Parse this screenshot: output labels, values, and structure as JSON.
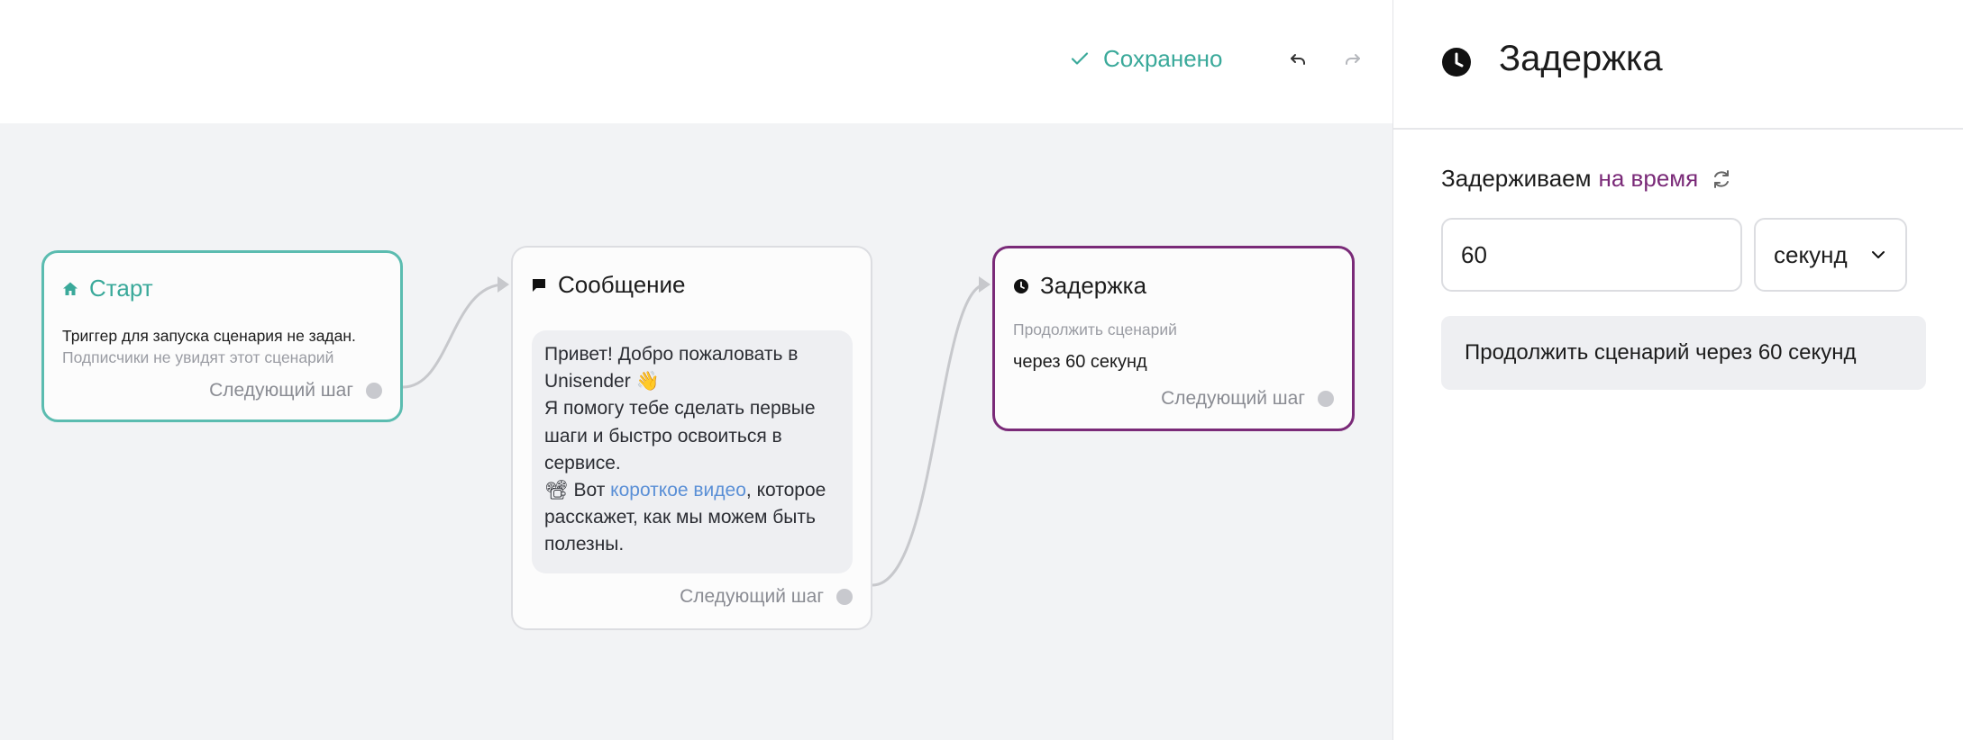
{
  "toolbar": {
    "saved_label": "Сохранено",
    "undo_icon": "undo-icon",
    "redo_icon": "redo-icon"
  },
  "nodes": {
    "start": {
      "icon": "home-icon",
      "title": "Старт",
      "line1": "Триггер для запуска сценария не задан.",
      "line2": "Подписчики не увидят этот сценарий",
      "next_step": "Следующий шаг"
    },
    "message": {
      "icon": "message-icon",
      "title": "Сообщение",
      "text_1": "Привет! Добро пожаловать в Unisender 👋",
      "text_2": "Я помогу тебе сделать первые шаги и быстро освоиться в сервисе.",
      "text_3_prefix": "📽 Вот ",
      "text_3_link": "короткое видео",
      "text_3_suffix": ", которое расскажет, как мы можем быть полезны.",
      "next_step": "Следующий шаг"
    },
    "delay": {
      "icon": "clock-icon",
      "title": "Задержка",
      "subtitle": "Продолжить сценарий",
      "value": "через 60 секунд",
      "next_step": "Следующий шаг"
    }
  },
  "panel": {
    "icon": "clock-icon",
    "title": "Задержка",
    "label_prefix": "Задерживаем",
    "label_mode": "на время",
    "switch_icon": "refresh-icon",
    "amount": "60",
    "unit": "секунд",
    "summary": "Продолжить сценарий через 60 секунд"
  },
  "colors": {
    "accent_teal": "#3aa99a",
    "start_border": "#5bbcb0",
    "delay_border": "#7a2a78",
    "link": "#5a8fd6",
    "canvas_bg": "#f2f3f5"
  }
}
